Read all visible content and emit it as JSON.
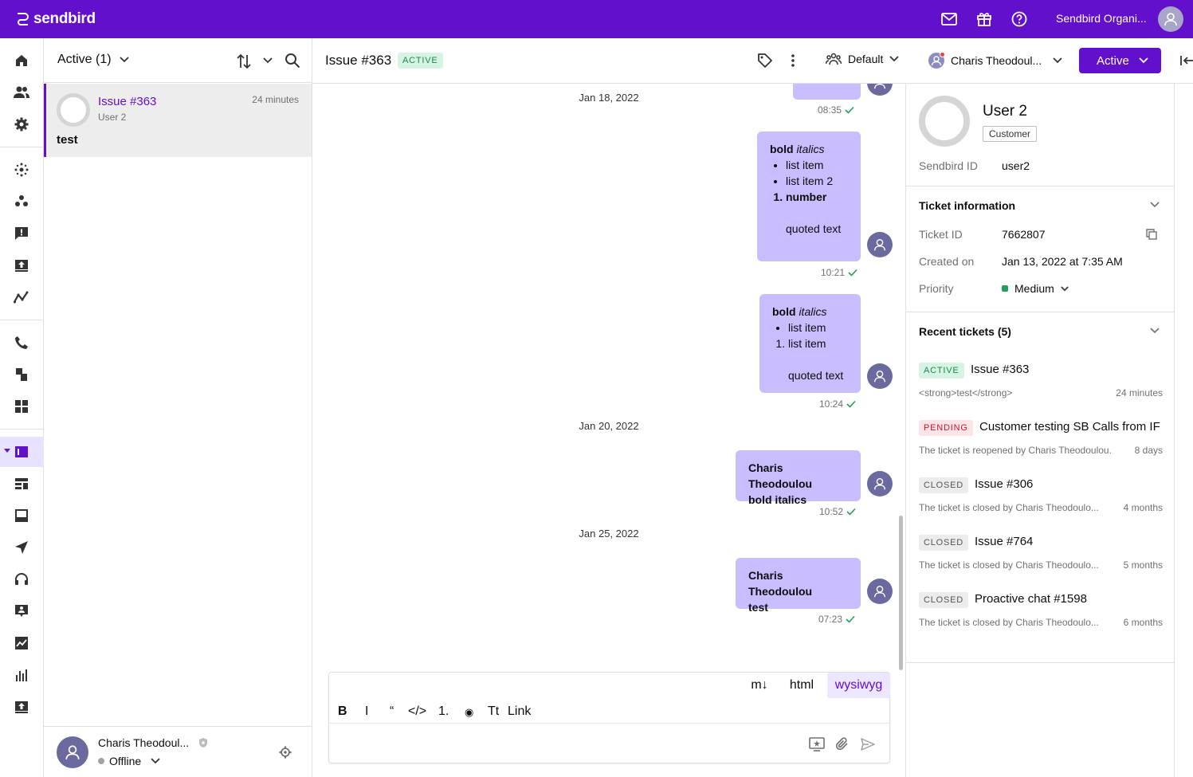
{
  "app": {
    "logo_text": "sendbird",
    "org_name": "Sendbird Organi...",
    "brand_color": "#6210cc"
  },
  "topbar": {
    "icons": [
      "mail-icon",
      "gift-icon",
      "help-icon"
    ]
  },
  "leftnav": {
    "icons": [
      "home-icon",
      "users-icon",
      "settings-icon",
      "hub-icon",
      "groups-icon",
      "report-icon",
      "upload-icon",
      "analytics-icon",
      "phone-icon",
      "devices-icon",
      "dashboard-icon",
      "tickets-icon",
      "ticket-list-icon",
      "inbox-icon",
      "send-icon",
      "headset-icon",
      "contact-icon",
      "trend-icon",
      "bar-chart-icon",
      "export-icon"
    ],
    "active": "tickets-icon"
  },
  "list": {
    "filter_label": "Active (1)",
    "ticket": {
      "title": "Issue #363",
      "user": "User 2",
      "time": "24 minutes",
      "message": "test"
    }
  },
  "agent": {
    "name": "Charis Theodoul...",
    "status": "Offline"
  },
  "header": {
    "issue_title": "Issue #363",
    "issue_status": "ACTIVE",
    "team": "Default",
    "assignee": "Charis Theodoul...",
    "status_button": "Active"
  },
  "conversation": {
    "dates": [
      "Jan 18, 2022",
      "Jan 20, 2022",
      "Jan 25, 2022"
    ],
    "messages": [
      {
        "time": "08:35"
      },
      {
        "bold": "bold",
        "italic": "italics",
        "bullets": [
          "list item",
          "list item 2"
        ],
        "numbered": [
          "number"
        ],
        "quote": "quoted text",
        "time": "10:21"
      },
      {
        "bold": "bold",
        "italic": "italics",
        "bullets": [
          "list item"
        ],
        "numbered": [
          "list item"
        ],
        "quote": "quoted text",
        "time": "10:24"
      },
      {
        "line1": "Charis Theodoulou",
        "line2": "bold italics",
        "time": "10:52"
      },
      {
        "line1": "Charis Theodoulou",
        "line2": "test",
        "time": "07:23"
      }
    ]
  },
  "composer": {
    "modes": [
      "m↓",
      "html",
      "wysiwyg"
    ],
    "active_mode": "wysiwyg",
    "format_buttons": [
      "B",
      "I",
      "“",
      "</>",
      "1.",
      "◉",
      "Tt",
      "Link"
    ]
  },
  "customer": {
    "name": "User 2",
    "role": "Customer",
    "id_label": "Sendbird ID",
    "id_value": "user2"
  },
  "ticket_info": {
    "title": "Ticket information",
    "ticket_id_label": "Ticket ID",
    "ticket_id": "7662807",
    "created_label": "Created on",
    "created": "Jan 13, 2022 at 7:35 AM",
    "priority_label": "Priority",
    "priority": "Medium"
  },
  "recent": {
    "title": "Recent tickets (5)",
    "items": [
      {
        "status": "ACTIVE",
        "title": "Issue #363",
        "desc": "<strong>test</strong>",
        "time": "24 minutes"
      },
      {
        "status": "PENDING",
        "title": "Customer testing SB Calls from IF",
        "desc": "The ticket is reopened by Charis Theodoulou.",
        "time": "8 days"
      },
      {
        "status": "CLOSED",
        "title": "Issue #306",
        "desc": "The ticket is closed by Charis Theodoulo...",
        "time": "4 months"
      },
      {
        "status": "CLOSED",
        "title": "Issue #764",
        "desc": "The ticket is closed by Charis Theodoulo...",
        "time": "5 months"
      },
      {
        "status": "CLOSED",
        "title": "Proactive chat #1598",
        "desc": "The ticket is closed by Charis Theodoulo...",
        "time": "6 months"
      }
    ]
  }
}
